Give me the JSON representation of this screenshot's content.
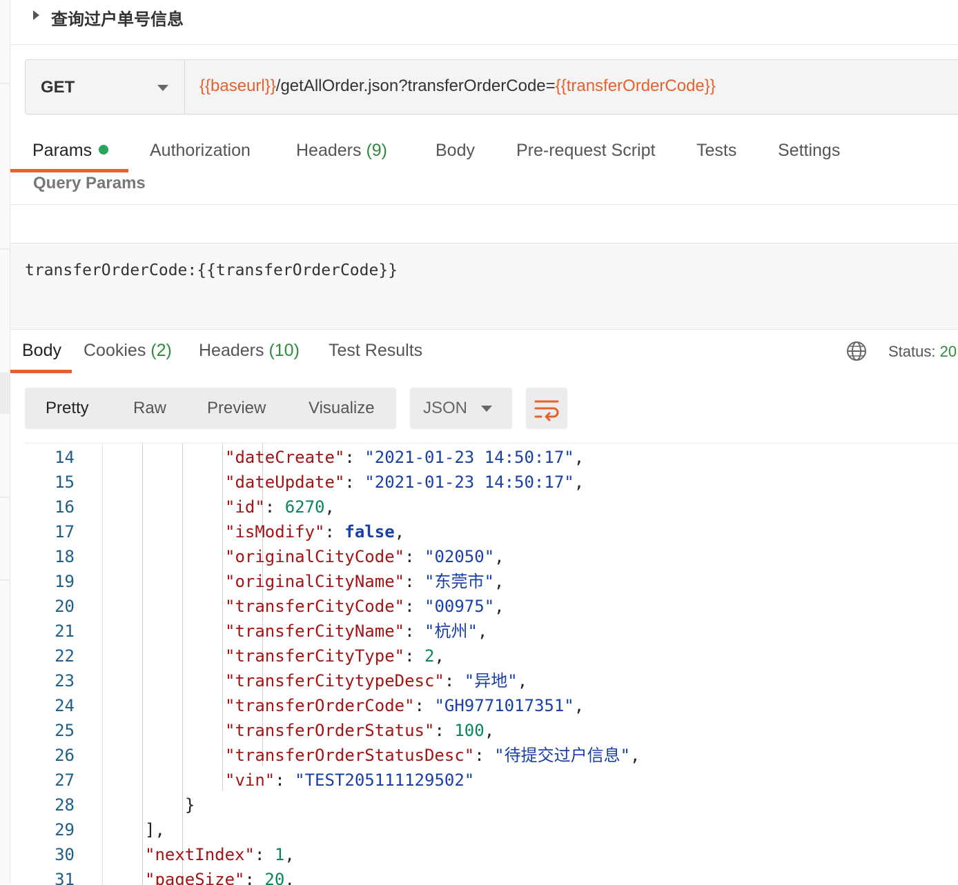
{
  "request": {
    "title": "查询过户单号信息",
    "method": "GET",
    "url_parts": [
      {
        "text": "{{baseurl}}",
        "var": true
      },
      {
        "text": "/getAllOrder.json?transferOrderCode=",
        "var": false
      },
      {
        "text": "{{transferOrderCode}}",
        "var": true
      }
    ]
  },
  "request_tabs": [
    {
      "label": "Params",
      "count": "",
      "active": true,
      "dot": true
    },
    {
      "label": "Authorization",
      "count": "",
      "active": false
    },
    {
      "label": "Headers",
      "count": "(9)",
      "active": false
    },
    {
      "label": "Body",
      "count": "",
      "active": false
    },
    {
      "label": "Pre-request Script",
      "count": "",
      "active": false
    },
    {
      "label": "Tests",
      "count": "",
      "active": false
    },
    {
      "label": "Settings",
      "count": "",
      "active": false
    }
  ],
  "query_params": {
    "label": "Query Params",
    "bulk_text": "transferOrderCode:{{transferOrderCode}}"
  },
  "response_tabs": [
    {
      "label": "Body",
      "count": "",
      "active": true
    },
    {
      "label": "Cookies",
      "count": "(2)",
      "active": false
    },
    {
      "label": "Headers",
      "count": "(10)",
      "active": false
    },
    {
      "label": "Test Results",
      "count": "",
      "active": false
    }
  ],
  "status": {
    "label": "Status:",
    "code": "20"
  },
  "view_modes": [
    {
      "label": "Pretty",
      "active": true
    },
    {
      "label": "Raw",
      "active": false
    },
    {
      "label": "Preview",
      "active": false
    },
    {
      "label": "Visualize",
      "active": false
    }
  ],
  "format": "JSON",
  "icons": {
    "globe": "globe-icon",
    "wrap": "wrap-lines-icon",
    "caret": "caret-right-icon",
    "dropdown": "chevron-down-icon"
  },
  "colors": {
    "accent": "#e8602c",
    "count_green": "#2e8b3e",
    "json_key": "#a31515",
    "json_string": "#1a40a8",
    "json_number": "#098658"
  },
  "code_lines": [
    {
      "n": "14",
      "indent": 4,
      "tokens": [
        {
          "t": "\"dateCreate\"",
          "c": "k"
        },
        {
          "t": ": ",
          "c": "p"
        },
        {
          "t": "\"2021-01-23 14:50:17\"",
          "c": "s"
        },
        {
          "t": ",",
          "c": "p"
        }
      ]
    },
    {
      "n": "15",
      "indent": 4,
      "tokens": [
        {
          "t": "\"dateUpdate\"",
          "c": "k"
        },
        {
          "t": ": ",
          "c": "p"
        },
        {
          "t": "\"2021-01-23 14:50:17\"",
          "c": "s"
        },
        {
          "t": ",",
          "c": "p"
        }
      ]
    },
    {
      "n": "16",
      "indent": 4,
      "tokens": [
        {
          "t": "\"id\"",
          "c": "k"
        },
        {
          "t": ": ",
          "c": "p"
        },
        {
          "t": "6270",
          "c": "n"
        },
        {
          "t": ",",
          "c": "p"
        }
      ]
    },
    {
      "n": "17",
      "indent": 4,
      "tokens": [
        {
          "t": "\"isModify\"",
          "c": "k"
        },
        {
          "t": ": ",
          "c": "p"
        },
        {
          "t": "false",
          "c": "b"
        },
        {
          "t": ",",
          "c": "p"
        }
      ]
    },
    {
      "n": "18",
      "indent": 4,
      "tokens": [
        {
          "t": "\"originalCityCode\"",
          "c": "k"
        },
        {
          "t": ": ",
          "c": "p"
        },
        {
          "t": "\"02050\"",
          "c": "s"
        },
        {
          "t": ",",
          "c": "p"
        }
      ]
    },
    {
      "n": "19",
      "indent": 4,
      "tokens": [
        {
          "t": "\"originalCityName\"",
          "c": "k"
        },
        {
          "t": ": ",
          "c": "p"
        },
        {
          "t": "\"东莞市\"",
          "c": "s"
        },
        {
          "t": ",",
          "c": "p"
        }
      ]
    },
    {
      "n": "20",
      "indent": 4,
      "tokens": [
        {
          "t": "\"transferCityCode\"",
          "c": "k"
        },
        {
          "t": ": ",
          "c": "p"
        },
        {
          "t": "\"00975\"",
          "c": "s"
        },
        {
          "t": ",",
          "c": "p"
        }
      ]
    },
    {
      "n": "21",
      "indent": 4,
      "tokens": [
        {
          "t": "\"transferCityName\"",
          "c": "k"
        },
        {
          "t": ": ",
          "c": "p"
        },
        {
          "t": "\"杭州\"",
          "c": "s"
        },
        {
          "t": ",",
          "c": "p"
        }
      ]
    },
    {
      "n": "22",
      "indent": 4,
      "tokens": [
        {
          "t": "\"transferCityType\"",
          "c": "k"
        },
        {
          "t": ": ",
          "c": "p"
        },
        {
          "t": "2",
          "c": "n"
        },
        {
          "t": ",",
          "c": "p"
        }
      ]
    },
    {
      "n": "23",
      "indent": 4,
      "tokens": [
        {
          "t": "\"transferCitytypeDesc\"",
          "c": "k"
        },
        {
          "t": ": ",
          "c": "p"
        },
        {
          "t": "\"异地\"",
          "c": "s"
        },
        {
          "t": ",",
          "c": "p"
        }
      ]
    },
    {
      "n": "24",
      "indent": 4,
      "tokens": [
        {
          "t": "\"transferOrderCode\"",
          "c": "k"
        },
        {
          "t": ": ",
          "c": "p"
        },
        {
          "t": "\"GH9771017351\"",
          "c": "s"
        },
        {
          "t": ",",
          "c": "p"
        }
      ]
    },
    {
      "n": "25",
      "indent": 4,
      "tokens": [
        {
          "t": "\"transferOrderStatus\"",
          "c": "k"
        },
        {
          "t": ": ",
          "c": "p"
        },
        {
          "t": "100",
          "c": "n"
        },
        {
          "t": ",",
          "c": "p"
        }
      ]
    },
    {
      "n": "26",
      "indent": 4,
      "tokens": [
        {
          "t": "\"transferOrderStatusDesc\"",
          "c": "k"
        },
        {
          "t": ": ",
          "c": "p"
        },
        {
          "t": "\"待提交过户信息\"",
          "c": "s"
        },
        {
          "t": ",",
          "c": "p"
        }
      ]
    },
    {
      "n": "27",
      "indent": 4,
      "tokens": [
        {
          "t": "\"vin\"",
          "c": "k"
        },
        {
          "t": ": ",
          "c": "p"
        },
        {
          "t": "\"TEST205111129502\"",
          "c": "s"
        }
      ]
    },
    {
      "n": "28",
      "indent": 3,
      "tokens": [
        {
          "t": "}",
          "c": "p"
        }
      ]
    },
    {
      "n": "29",
      "indent": 2,
      "tokens": [
        {
          "t": "],",
          "c": "p"
        }
      ]
    },
    {
      "n": "30",
      "indent": 2,
      "tokens": [
        {
          "t": "\"nextIndex\"",
          "c": "k"
        },
        {
          "t": ": ",
          "c": "p"
        },
        {
          "t": "1",
          "c": "n"
        },
        {
          "t": ",",
          "c": "p"
        }
      ]
    },
    {
      "n": "31",
      "indent": 2,
      "tokens": [
        {
          "t": "\"pageSize\"",
          "c": "k"
        },
        {
          "t": ": ",
          "c": "p"
        },
        {
          "t": "20",
          "c": "n"
        },
        {
          "t": ",",
          "c": "p"
        }
      ]
    }
  ]
}
